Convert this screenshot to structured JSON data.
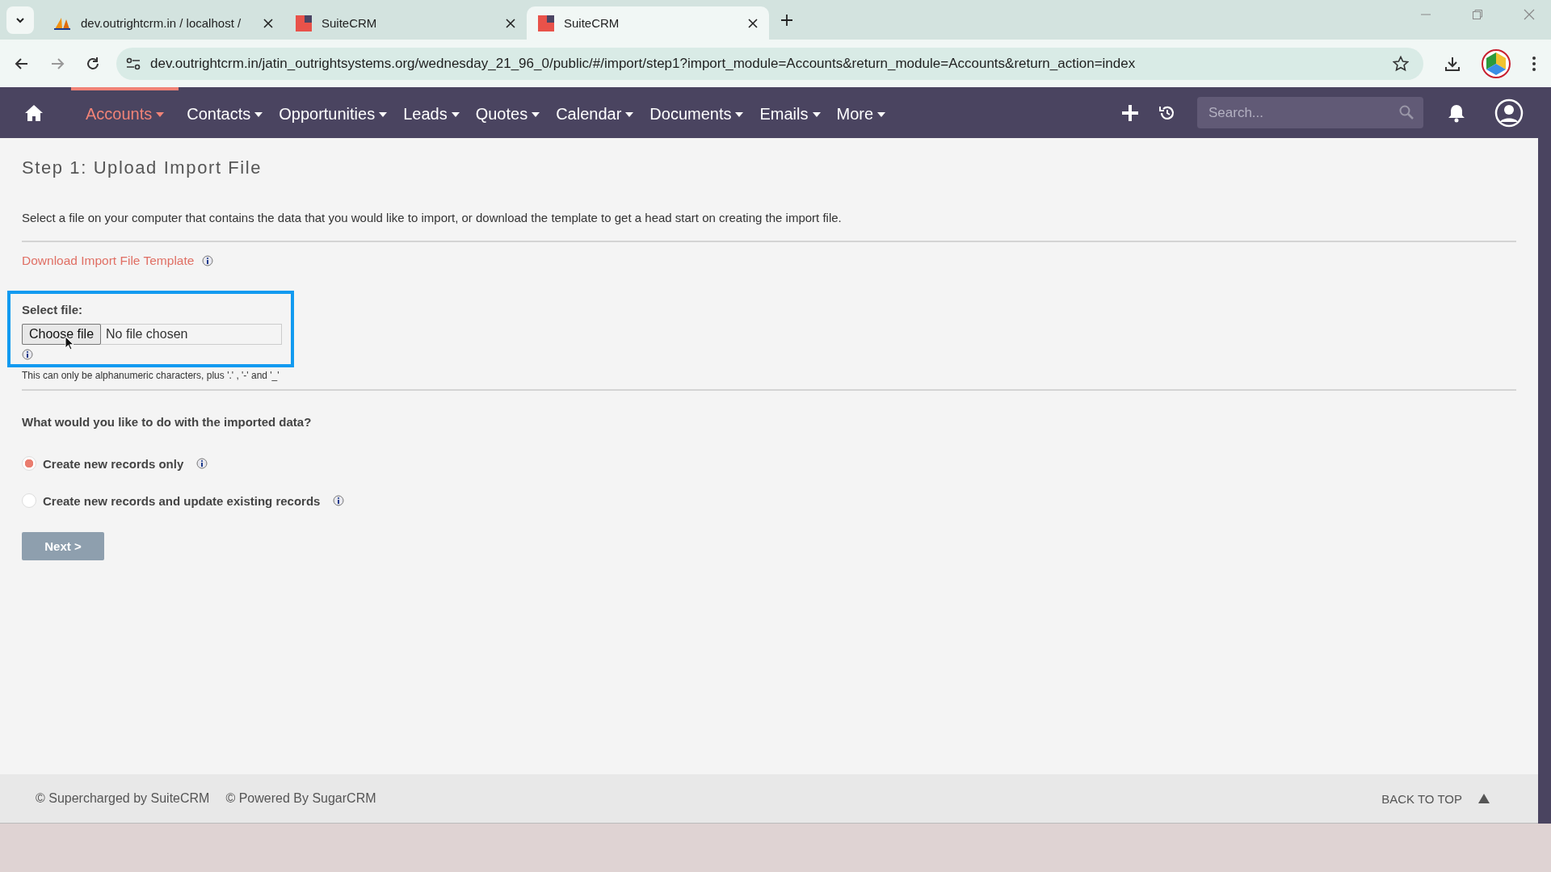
{
  "browser": {
    "tabs": [
      {
        "title": "dev.outrightcrm.in / localhost /",
        "kind": "pma",
        "selected": false
      },
      {
        "title": "SuiteCRM",
        "kind": "suitecrm",
        "selected": false
      },
      {
        "title": "SuiteCRM",
        "kind": "suitecrm",
        "selected": true
      }
    ],
    "address": "dev.outrightcrm.in/jatin_outrightsystems.org/wednesday_21_96_0/public/#/import/step1?import_module=Accounts&return_module=Accounts&return_action=index"
  },
  "nav": {
    "items": [
      {
        "label": "Accounts",
        "selected": true
      },
      {
        "label": "Contacts",
        "selected": false
      },
      {
        "label": "Opportunities",
        "selected": false
      },
      {
        "label": "Leads",
        "selected": false
      },
      {
        "label": "Quotes",
        "selected": false
      },
      {
        "label": "Calendar",
        "selected": false
      },
      {
        "label": "Documents",
        "selected": false
      },
      {
        "label": "Emails",
        "selected": false
      },
      {
        "label": "More",
        "selected": false
      }
    ],
    "search_placeholder": "Search..."
  },
  "page": {
    "title": "Step 1: Upload Import File",
    "intro": "Select a file on your computer that contains the data that you would like to import, or download the template to get a head start on creating the import file.",
    "download_link": "Download Import File Template",
    "select_file_label": "Select file:",
    "choose_button": "Choose file",
    "file_status": "No file chosen",
    "hint": "This can only be alphanumeric characters, plus '.' , '-' and '_'",
    "question": "What would you like to do with the imported data?",
    "options": [
      {
        "label": "Create new records only",
        "selected": true
      },
      {
        "label": "Create new records and update existing records",
        "selected": false
      }
    ],
    "next_button": "Next >"
  },
  "footer": {
    "credits": [
      "© Supercharged by SuiteCRM",
      "© Powered By SugarCRM"
    ],
    "back_to_top": "BACK TO TOP"
  }
}
